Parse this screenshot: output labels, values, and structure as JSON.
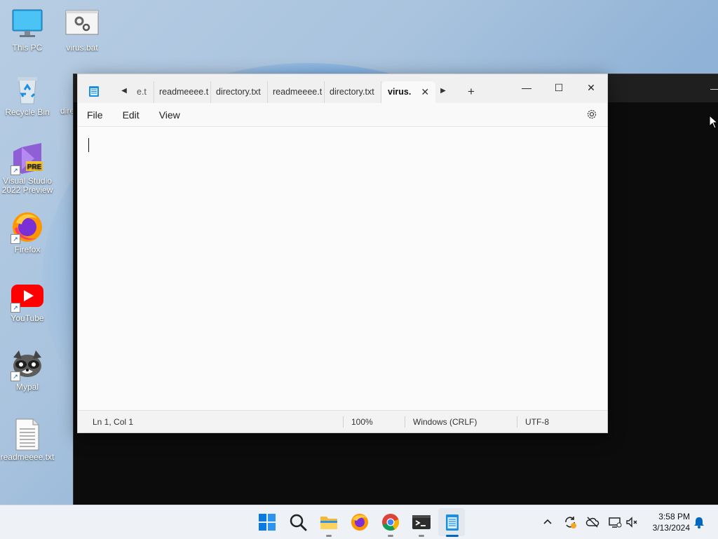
{
  "desktop": {
    "icons": [
      {
        "label": "This PC",
        "icon": "monitor-icon"
      },
      {
        "label": "virus.bat",
        "icon": "batch-file-icon"
      },
      {
        "label": "Recycle Bin",
        "icon": "recycle-bin-icon"
      },
      {
        "label": "dire",
        "icon": "partial-label"
      },
      {
        "label": "Visual Studio 2022 Preview",
        "icon": "visual-studio-preview-icon",
        "badge": "PRE"
      },
      {
        "label": "Firefox",
        "icon": "firefox-icon"
      },
      {
        "label": "YouTube",
        "icon": "youtube-icon"
      },
      {
        "label": "Mypal",
        "icon": "mypal-icon"
      },
      {
        "label": "readmeeee.txt",
        "icon": "text-file-icon"
      }
    ]
  },
  "notepad": {
    "tabs": [
      {
        "label": "e.t"
      },
      {
        "label": "readmeeee.t"
      },
      {
        "label": "directory.txt"
      },
      {
        "label": "readmeeee.t"
      },
      {
        "label": "directory.txt"
      },
      {
        "label": "virus.",
        "active": true
      }
    ],
    "menu": [
      "File",
      "Edit",
      "View"
    ],
    "status": {
      "position": "Ln 1, Col 1",
      "zoom": "100%",
      "line_ending": "Windows (CRLF)",
      "encoding": "UTF-8"
    }
  },
  "taskbar": {
    "apps": [
      "start-icon",
      "search-icon",
      "file-explorer-icon",
      "firefox-icon",
      "chrome-icon",
      "terminal-icon",
      "notepad-icon"
    ],
    "tray": [
      "chevron-up-icon",
      "sync-icon",
      "cloud-off-icon",
      "display-icon",
      "volume-muted-icon",
      "bell-icon"
    ],
    "clock": {
      "time": "3:58 PM",
      "date": "3/13/2024"
    }
  },
  "colors": {
    "accent": "#0067c0",
    "taskbar": "#eef2f6",
    "terminal": "#0c0c0c"
  }
}
